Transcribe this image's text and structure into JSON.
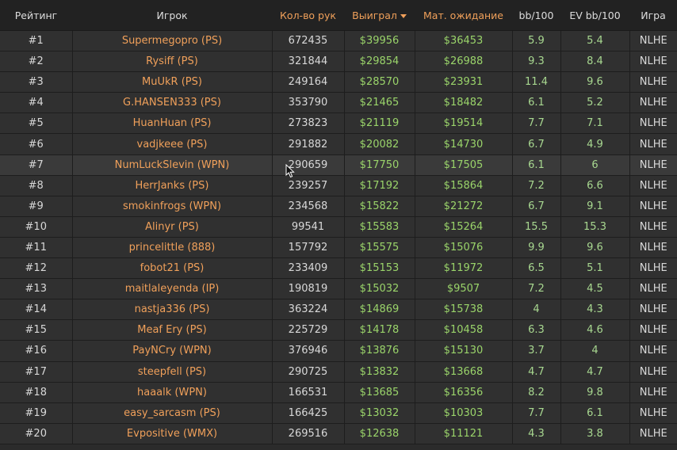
{
  "header": {
    "rank": "Рейтинг",
    "player": "Игрок",
    "hands": "Кол-во рук",
    "won": "Выиграл",
    "ev": "Мат. ожидание",
    "bb": "bb/100",
    "evbb": "EV bb/100",
    "game": "Игра"
  },
  "colors": {
    "accent": "#f0a05a",
    "money": "#9ad46a",
    "background": "#2b2b2b"
  },
  "rows": [
    {
      "rank": "#1",
      "player": "Supermegopro (PS)",
      "hands": "672435",
      "won": "$39956",
      "ev": "$36453",
      "bb": "5.9",
      "evbb": "5.4",
      "game": "NLHE"
    },
    {
      "rank": "#2",
      "player": "Rysiff (PS)",
      "hands": "321844",
      "won": "$29854",
      "ev": "$26988",
      "bb": "9.3",
      "evbb": "8.4",
      "game": "NLHE"
    },
    {
      "rank": "#3",
      "player": "MuUkR (PS)",
      "hands": "249164",
      "won": "$28570",
      "ev": "$23931",
      "bb": "11.4",
      "evbb": "9.6",
      "game": "NLHE"
    },
    {
      "rank": "#4",
      "player": "G.HANSEN333 (PS)",
      "hands": "353790",
      "won": "$21465",
      "ev": "$18482",
      "bb": "6.1",
      "evbb": "5.2",
      "game": "NLHE"
    },
    {
      "rank": "#5",
      "player": "HuanHuan (PS)",
      "hands": "273823",
      "won": "$21119",
      "ev": "$19514",
      "bb": "7.7",
      "evbb": "7.1",
      "game": "NLHE"
    },
    {
      "rank": "#6",
      "player": "vadjkeee (PS)",
      "hands": "291882",
      "won": "$20082",
      "ev": "$14730",
      "bb": "6.7",
      "evbb": "4.9",
      "game": "NLHE"
    },
    {
      "rank": "#7",
      "player": "NumLuckSlevin (WPN)",
      "hands": "290659",
      "won": "$17750",
      "ev": "$17505",
      "bb": "6.1",
      "evbb": "6",
      "game": "NLHE"
    },
    {
      "rank": "#8",
      "player": "HerrJanks (PS)",
      "hands": "239257",
      "won": "$17192",
      "ev": "$15864",
      "bb": "7.2",
      "evbb": "6.6",
      "game": "NLHE"
    },
    {
      "rank": "#9",
      "player": "smokinfrogs (WPN)",
      "hands": "234568",
      "won": "$15822",
      "ev": "$21272",
      "bb": "6.7",
      "evbb": "9.1",
      "game": "NLHE"
    },
    {
      "rank": "#10",
      "player": "Alinyr (PS)",
      "hands": "99541",
      "won": "$15583",
      "ev": "$15264",
      "bb": "15.5",
      "evbb": "15.3",
      "game": "NLHE"
    },
    {
      "rank": "#11",
      "player": "princelittle (888)",
      "hands": "157792",
      "won": "$15575",
      "ev": "$15076",
      "bb": "9.9",
      "evbb": "9.6",
      "game": "NLHE"
    },
    {
      "rank": "#12",
      "player": "fobot21 (PS)",
      "hands": "233409",
      "won": "$15153",
      "ev": "$11972",
      "bb": "6.5",
      "evbb": "5.1",
      "game": "NLHE"
    },
    {
      "rank": "#13",
      "player": "maitlaleyenda (IP)",
      "hands": "190819",
      "won": "$15032",
      "ev": "$9507",
      "bb": "7.2",
      "evbb": "4.5",
      "game": "NLHE"
    },
    {
      "rank": "#14",
      "player": "nastja336 (PS)",
      "hands": "363224",
      "won": "$14869",
      "ev": "$15738",
      "bb": "4",
      "evbb": "4.3",
      "game": "NLHE"
    },
    {
      "rank": "#15",
      "player": "Meaf Ery (PS)",
      "hands": "225729",
      "won": "$14178",
      "ev": "$10458",
      "bb": "6.3",
      "evbb": "4.6",
      "game": "NLHE"
    },
    {
      "rank": "#16",
      "player": "PayNCry (WPN)",
      "hands": "376946",
      "won": "$13876",
      "ev": "$15130",
      "bb": "3.7",
      "evbb": "4",
      "game": "NLHE"
    },
    {
      "rank": "#17",
      "player": "steepfell (PS)",
      "hands": "290725",
      "won": "$13832",
      "ev": "$13668",
      "bb": "4.7",
      "evbb": "4.7",
      "game": "NLHE"
    },
    {
      "rank": "#18",
      "player": "haaalk (WPN)",
      "hands": "166531",
      "won": "$13685",
      "ev": "$16356",
      "bb": "8.2",
      "evbb": "9.8",
      "game": "NLHE"
    },
    {
      "rank": "#19",
      "player": "easy_sarcasm (PS)",
      "hands": "166425",
      "won": "$13032",
      "ev": "$10303",
      "bb": "7.7",
      "evbb": "6.1",
      "game": "NLHE"
    },
    {
      "rank": "#20",
      "player": "Evpositive (WMX)",
      "hands": "269516",
      "won": "$12638",
      "ev": "$11121",
      "bb": "4.3",
      "evbb": "3.8",
      "game": "NLHE"
    }
  ]
}
